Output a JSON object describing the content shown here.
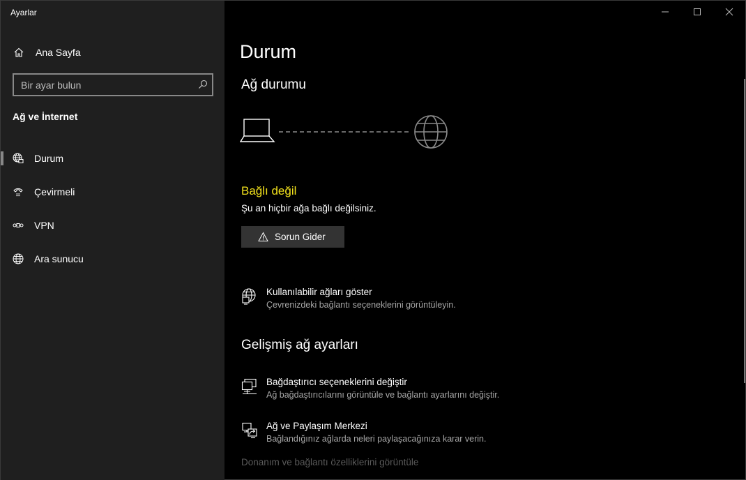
{
  "window": {
    "title": "Ayarlar"
  },
  "sidebar": {
    "home_label": "Ana Sayfa",
    "search_placeholder": "Bir ayar bulun",
    "section_title": "Ağ ve İnternet",
    "items": [
      {
        "label": "Durum",
        "icon": "globe-network-icon",
        "active": true
      },
      {
        "label": "Çevirmeli",
        "icon": "dialup-icon",
        "active": false
      },
      {
        "label": "VPN",
        "icon": "vpn-icon",
        "active": false
      },
      {
        "label": "Ara sunucu",
        "icon": "globe-icon",
        "active": false
      }
    ]
  },
  "main": {
    "page_title": "Durum",
    "network_status_title": "Ağ durumu",
    "status": {
      "title": "Bağlı değil",
      "description": "Şu an hiçbir ağa bağlı değilsiniz.",
      "title_color": "#f3e21c"
    },
    "troubleshoot_label": "Sorun Gider",
    "show_networks": {
      "title": "Kullanılabilir ağları göster",
      "description": "Çevrenizdeki bağlantı seçeneklerini görüntüleyin."
    },
    "advanced_title": "Gelişmiş ağ ayarları",
    "adapter_options": {
      "title": "Bağdaştırıcı seçeneklerini değiştir",
      "description": "Ağ bağdaştırıcılarını görüntüle ve bağlantı ayarlarını değiştir."
    },
    "sharing_center": {
      "title": "Ağ ve Paylaşım Merkezi",
      "description": "Bağlandığınız ağlarda neleri paylaşacağınıza karar verin."
    },
    "hardware_link": "Donanım ve bağlantı özelliklerini görüntüle"
  }
}
